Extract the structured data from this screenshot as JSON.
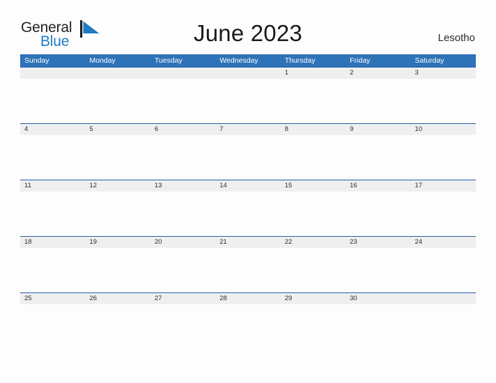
{
  "brand": {
    "name_part1": "General",
    "name_part2": "Blue",
    "mark": "triangle-flag-icon"
  },
  "header": {
    "title": "June 2023",
    "country": "Lesotho"
  },
  "colors": {
    "header_blue": "#2e72b8",
    "row_border_blue": "#205fa6",
    "date_band_gray": "#efefef",
    "brand_blue": "#1f7bc1",
    "page_background": "#fdfdfd"
  },
  "calendar": {
    "weekdays": [
      "Sunday",
      "Monday",
      "Tuesday",
      "Wednesday",
      "Thursday",
      "Friday",
      "Saturday"
    ],
    "weeks": [
      [
        "",
        "",
        "",
        "",
        "1",
        "2",
        "3"
      ],
      [
        "4",
        "5",
        "6",
        "7",
        "8",
        "9",
        "10"
      ],
      [
        "11",
        "12",
        "13",
        "14",
        "15",
        "16",
        "17"
      ],
      [
        "18",
        "19",
        "20",
        "21",
        "22",
        "23",
        "24"
      ],
      [
        "25",
        "26",
        "27",
        "28",
        "29",
        "30",
        ""
      ]
    ]
  }
}
